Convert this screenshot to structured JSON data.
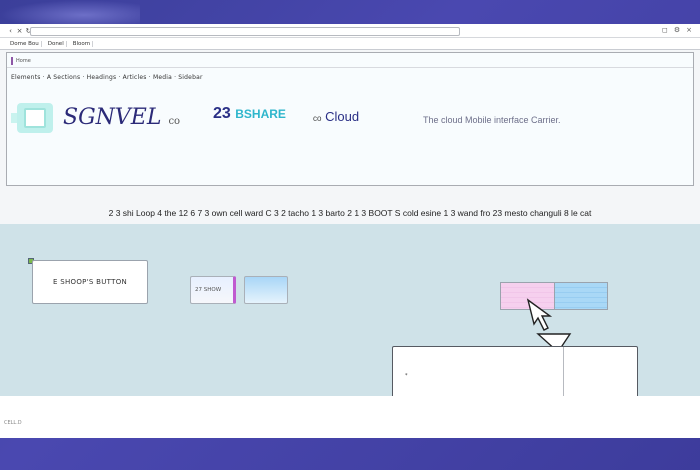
{
  "browser": {
    "address": "",
    "back_icon": "back-arrow-icon",
    "close_icon": "close-icon"
  },
  "bookmarks": [
    {
      "label": "Dome Bou"
    },
    {
      "label": "Donel"
    },
    {
      "label": "Bloom"
    }
  ],
  "header": {
    "tab_label": "Home",
    "meta_text": "Elements · A Sections · Headings · Articles · Media · Sidebar",
    "brand_main": "SGNVEL",
    "brand_small": "co",
    "stat_number": "23",
    "stat_accent": "BSHARE",
    "stat2_prefix": "co",
    "stat2_main": "Cloud",
    "tagline": "The cloud Mobile interface Carrier."
  },
  "info_strip": {
    "text": "2 3 shi Loop 4 the 12 6 7 3  own cell ward  C 3 2 tacho  1 3 barto  2 1 3 BOOT S cold  esine  1 3  wand fro 23 mesto  changuli  8 le  cat"
  },
  "canvas": {
    "cta_label": "E SHOOP'S BUTTON",
    "chip_a_label": "27 SHOW",
    "chip_b_label": "",
    "pointer_icon": "pointer-cursor-icon",
    "dialog_text": "*"
  },
  "footer": {
    "text": "CELL.D"
  }
}
